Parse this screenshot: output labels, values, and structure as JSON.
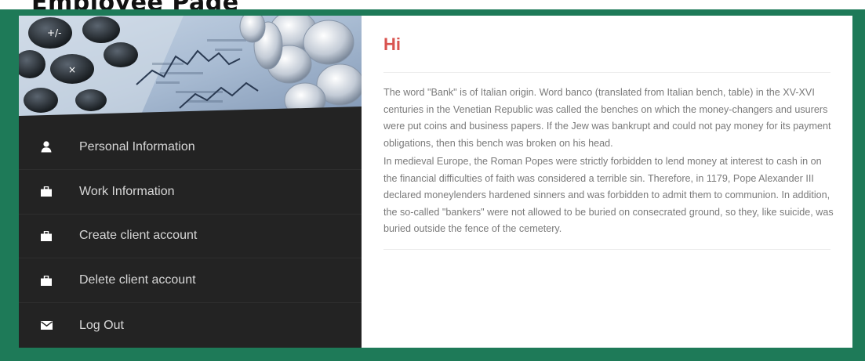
{
  "page": {
    "title": "Employee Page"
  },
  "sidebar": {
    "banner": {
      "description_icon": "finance-banner-image"
    },
    "items": [
      {
        "label": "Personal Information",
        "icon": "user-icon"
      },
      {
        "label": "Work Information",
        "icon": "briefcase-icon"
      },
      {
        "label": "Create client account",
        "icon": "briefcase-icon"
      },
      {
        "label": "Delete client account",
        "icon": "briefcase-icon"
      },
      {
        "label": "Log Out",
        "icon": "envelope-icon"
      }
    ]
  },
  "main": {
    "greeting": "Hi",
    "paragraphs": [
      "The word \"Bank\" is of Italian origin. Word banco (translated from Italian bench, table) in the XV-XVI centuries in the Venetian Republic was called the benches on which the money-changers and usurers were put coins and business papers. If the Jew was bankrupt and could not pay money for its payment obligations, then this bench was broken on his head.",
      "In medieval Europe, the Roman Popes were strictly forbidden to lend money at interest to cash in on the financial difficulties of faith was considered a terrible sin. Therefore, in 1179, Pope Alexander III declared moneylenders hardened sinners and was forbidden to admit them to communion. In addition, the so-called \"bankers\" were not allowed to be buried on consecrated ground, so they, like suicide, was buried outside the fence of the cemetery."
    ]
  },
  "colors": {
    "frame": "#1e7a58",
    "sidebar": "#232323",
    "greeting": "#d9534f",
    "body_text": "#7a7a7a"
  }
}
